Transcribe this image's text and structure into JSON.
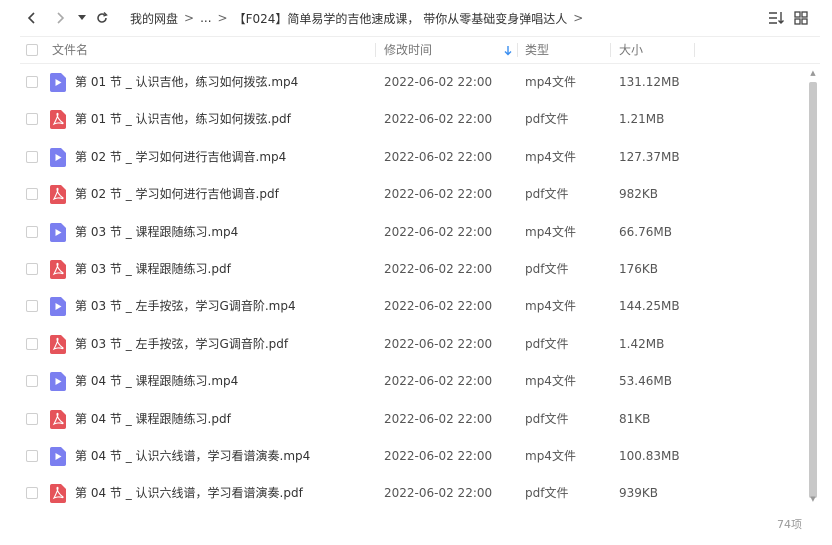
{
  "toolbar": {
    "breadcrumb": [
      {
        "label": "我的网盘"
      },
      {
        "label": "..."
      },
      {
        "label": "【F024】简单易学的吉他速成课， 带你从零基础变身弹唱达人"
      }
    ],
    "separator": ">"
  },
  "columns": {
    "name": "文件名",
    "modified": "修改时间",
    "type": "类型",
    "size": "大小"
  },
  "colors": {
    "video_icon": "#7b7ff0",
    "pdf_icon": "#e5535a",
    "sort_arrow": "#3a8ef0"
  },
  "files": [
    {
      "name": "第 01 节 _ 认识吉他，练习如何拨弦.mp4",
      "time": "2022-06-02 22:00",
      "type": "mp4文件",
      "size": "131.12MB",
      "icon": "video-file-icon"
    },
    {
      "name": "第 01 节 _ 认识吉他，练习如何拨弦.pdf",
      "time": "2022-06-02 22:00",
      "type": "pdf文件",
      "size": "1.21MB",
      "icon": "pdf-file-icon"
    },
    {
      "name": "第 02 节 _ 学习如何进行吉他调音.mp4",
      "time": "2022-06-02 22:00",
      "type": "mp4文件",
      "size": "127.37MB",
      "icon": "video-file-icon"
    },
    {
      "name": "第 02 节 _ 学习如何进行吉他调音.pdf",
      "time": "2022-06-02 22:00",
      "type": "pdf文件",
      "size": "982KB",
      "icon": "pdf-file-icon"
    },
    {
      "name": "第 03 节 _ 课程跟随练习.mp4",
      "time": "2022-06-02 22:00",
      "type": "mp4文件",
      "size": "66.76MB",
      "icon": "video-file-icon"
    },
    {
      "name": "第 03 节 _ 课程跟随练习.pdf",
      "time": "2022-06-02 22:00",
      "type": "pdf文件",
      "size": "176KB",
      "icon": "pdf-file-icon"
    },
    {
      "name": "第 03 节 _ 左手按弦，学习G调音阶.mp4",
      "time": "2022-06-02 22:00",
      "type": "mp4文件",
      "size": "144.25MB",
      "icon": "video-file-icon"
    },
    {
      "name": "第 03 节 _ 左手按弦，学习G调音阶.pdf",
      "time": "2022-06-02 22:00",
      "type": "pdf文件",
      "size": "1.42MB",
      "icon": "pdf-file-icon"
    },
    {
      "name": "第 04 节 _ 课程跟随练习.mp4",
      "time": "2022-06-02 22:00",
      "type": "mp4文件",
      "size": "53.46MB",
      "icon": "video-file-icon"
    },
    {
      "name": "第 04 节 _ 课程跟随练习.pdf",
      "time": "2022-06-02 22:00",
      "type": "pdf文件",
      "size": "81KB",
      "icon": "pdf-file-icon"
    },
    {
      "name": "第 04 节 _ 认识六线谱，学习看谱演奏.mp4",
      "time": "2022-06-02 22:00",
      "type": "mp4文件",
      "size": "100.83MB",
      "icon": "video-file-icon"
    },
    {
      "name": "第 04 节 _ 认识六线谱，学习看谱演奏.pdf",
      "time": "2022-06-02 22:00",
      "type": "pdf文件",
      "size": "939KB",
      "icon": "pdf-file-icon"
    }
  ],
  "footer": {
    "count": "74项"
  }
}
